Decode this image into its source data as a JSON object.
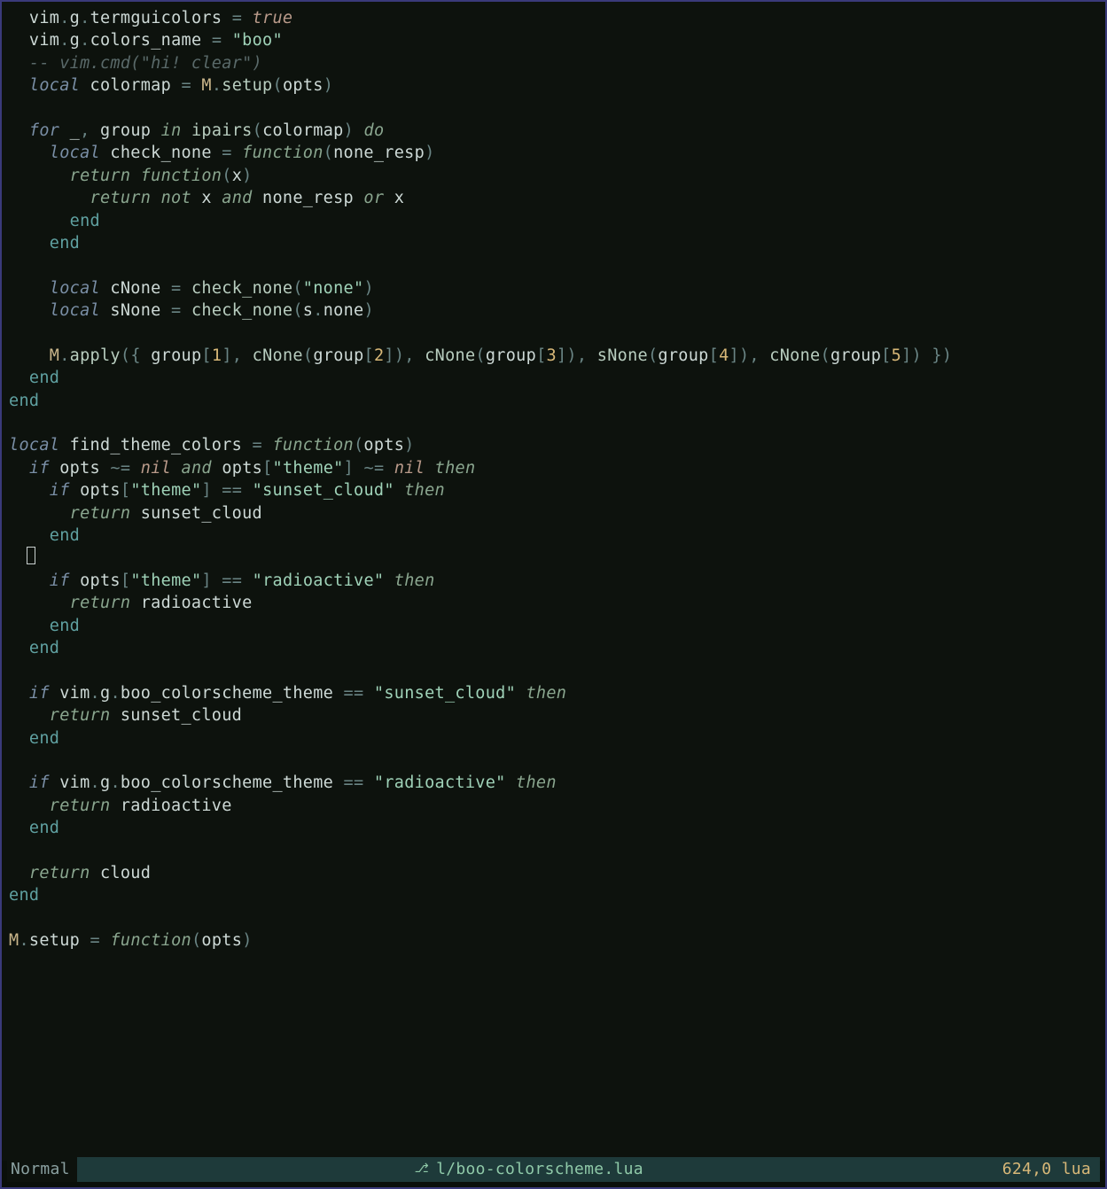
{
  "status": {
    "mode": "Normal",
    "filename": "l/boo-colorscheme.lua",
    "lineinfo": "624,0",
    "filetype": "lua"
  },
  "code": {
    "l1": {
      "a": "  vim",
      "b": ".",
      "c": "g",
      "d": ".",
      "e": "termguicolors ",
      "f": "=",
      "g": " ",
      "h": "true"
    },
    "l2": {
      "a": "  vim",
      "b": ".",
      "c": "g",
      "d": ".",
      "e": "colors_name ",
      "f": "=",
      "g": " ",
      "h": "\"boo\""
    },
    "l3": {
      "a": "  -- vim.cmd(\"hi! clear\")"
    },
    "l4": {
      "a": "  ",
      "b": "local",
      "c": " colormap ",
      "d": "=",
      "e": " ",
      "f": "M",
      "g": ".",
      "h": "setup",
      "i": "(",
      "j": "opts",
      "k": ")"
    },
    "l5": {
      "a": ""
    },
    "l6": {
      "a": "  ",
      "b": "for",
      "c": " _",
      "d": ",",
      "e": " group ",
      "f": "in",
      "g": " ",
      "h": "ipairs",
      "i": "(",
      "j": "colormap",
      "k": ")",
      "l": " ",
      "m": "do"
    },
    "l7": {
      "a": "    ",
      "b": "local",
      "c": " check_none ",
      "d": "=",
      "e": " ",
      "f": "function",
      "g": "(",
      "h": "none_resp",
      "i": ")"
    },
    "l8": {
      "a": "      ",
      "b": "return",
      "c": " ",
      "d": "function",
      "e": "(",
      "f": "x",
      "g": ")"
    },
    "l9": {
      "a": "        ",
      "b": "return",
      "c": " ",
      "d": "not",
      "e": " x ",
      "f": "and",
      "g": " none_resp ",
      "h": "or",
      "i": " x"
    },
    "l10": {
      "a": "      ",
      "b": "end"
    },
    "l11": {
      "a": "    ",
      "b": "end"
    },
    "l12": {
      "a": ""
    },
    "l13": {
      "a": "    ",
      "b": "local",
      "c": " cNone ",
      "d": "=",
      "e": " ",
      "f": "check_none",
      "g": "(",
      "h": "\"none\"",
      "i": ")"
    },
    "l14": {
      "a": "    ",
      "b": "local",
      "c": " sNone ",
      "d": "=",
      "e": " ",
      "f": "check_none",
      "g": "(",
      "h": "s",
      "i": ".",
      "j": "none",
      "k": ")"
    },
    "l15": {
      "a": ""
    },
    "l16": {
      "a": "    ",
      "b": "M",
      "c": ".",
      "d": "apply",
      "e": "({",
      "f": " group",
      "g": "[",
      "h": "1",
      "i": "],",
      "j": " ",
      "k": "cNone",
      "l": "(",
      "m": "group",
      "n": "[",
      "o": "2",
      "p": "]),",
      "q": " ",
      "r": "cNone",
      "s": "(",
      "t": "group",
      "u": "[",
      "v": "3",
      "w": "]),",
      "x": " ",
      "y": "sNone",
      "z": "(",
      "aa": "group",
      "ab": "[",
      "ac": "4",
      "ad": "]),",
      "ae": " ",
      "af": "cNone",
      "ag": "(",
      "ah": "group",
      "ai": "[",
      "aj": "5",
      "ak": "]) })"
    },
    "l17": {
      "a": "  ",
      "b": "end"
    },
    "l18": {
      "a": "",
      "b": "end"
    },
    "l19": {
      "a": ""
    },
    "l20": {
      "a": "",
      "b": "local",
      "c": " find_theme_colors ",
      "d": "=",
      "e": " ",
      "f": "function",
      "g": "(",
      "h": "opts",
      "i": ")"
    },
    "l21": {
      "a": "  ",
      "b": "if",
      "c": " opts ",
      "d": "~=",
      "e": " ",
      "f": "nil",
      "g": " ",
      "h": "and",
      "i": " opts",
      "j": "[",
      "k": "\"theme\"",
      "l": "]",
      "m": " ",
      "n": "~=",
      "o": " ",
      "p": "nil",
      "q": " ",
      "r": "then"
    },
    "l22": {
      "a": "    ",
      "b": "if",
      "c": " opts",
      "d": "[",
      "e": "\"theme\"",
      "f": "]",
      "g": " ",
      "h": "==",
      "i": " ",
      "j": "\"sunset_cloud\"",
      "k": " ",
      "l": "then"
    },
    "l23": {
      "a": "      ",
      "b": "return",
      "c": " sunset_cloud"
    },
    "l24": {
      "a": "    ",
      "b": "end"
    },
    "l25": {
      "a": ""
    },
    "l26": {
      "a": "    ",
      "b": "if",
      "c": " opts",
      "d": "[",
      "e": "\"theme\"",
      "f": "]",
      "g": " ",
      "h": "==",
      "i": " ",
      "j": "\"radioactive\"",
      "k": " ",
      "l": "then"
    },
    "l27": {
      "a": "      ",
      "b": "return",
      "c": " radioactive"
    },
    "l28": {
      "a": "    ",
      "b": "end"
    },
    "l29": {
      "a": "  ",
      "b": "end"
    },
    "l30": {
      "a": ""
    },
    "l31": {
      "a": "  ",
      "b": "if",
      "c": " vim",
      "d": ".",
      "e": "g",
      "f": ".",
      "g": "boo_colorscheme_theme ",
      "h": "==",
      "i": " ",
      "j": "\"sunset_cloud\"",
      "k": " ",
      "l": "then"
    },
    "l32": {
      "a": "    ",
      "b": "return",
      "c": " sunset_cloud"
    },
    "l33": {
      "a": "  ",
      "b": "end"
    },
    "l34": {
      "a": ""
    },
    "l35": {
      "a": "  ",
      "b": "if",
      "c": " vim",
      "d": ".",
      "e": "g",
      "f": ".",
      "g": "boo_colorscheme_theme ",
      "h": "==",
      "i": " ",
      "j": "\"radioactive\"",
      "k": " ",
      "l": "then"
    },
    "l36": {
      "a": "    ",
      "b": "return",
      "c": " radioactive"
    },
    "l37": {
      "a": "  ",
      "b": "end"
    },
    "l38": {
      "a": ""
    },
    "l39": {
      "a": "  ",
      "b": "return",
      "c": " cloud"
    },
    "l40": {
      "a": "",
      "b": "end"
    },
    "l41": {
      "a": ""
    },
    "l42": {
      "a": "",
      "b": "M",
      "c": ".",
      "d": "setup ",
      "e": "=",
      "f": " ",
      "g": "function",
      "h": "(",
      "i": "opts",
      "j": ")"
    }
  }
}
